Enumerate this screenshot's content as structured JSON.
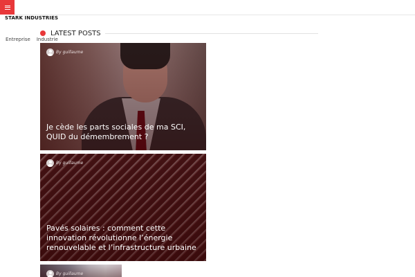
{
  "header": {
    "site_title": "STARK INDUSTRIES"
  },
  "nav": {
    "categories": [
      "Entreprise",
      "Industrie"
    ]
  },
  "section": {
    "title": "LATEST POSTS"
  },
  "posts": [
    {
      "author": "By guillaume",
      "title": "Je cède les parts sociales de ma SCI, QUID du démembrement ?"
    },
    {
      "author": "By guillaume",
      "title": "Pavés solaires : comment cette innovation révolutionne l’énergie renouvelable et l’infrastructure urbaine"
    },
    {
      "author": "By guillaume",
      "title": ""
    }
  ],
  "colors": {
    "accent": "#e8383a"
  },
  "icons": {
    "menu": "hamburger-menu-icon",
    "avatar": "user-avatar-icon"
  }
}
